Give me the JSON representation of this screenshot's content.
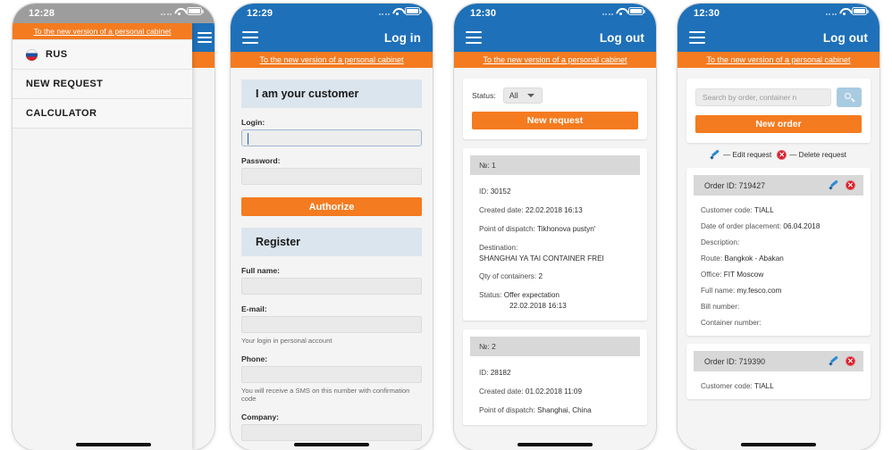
{
  "common": {
    "promo_link": "To the new version of a personal cabinet",
    "menu_icon": "hamburger-menu-icon",
    "wifi_icon": "wifi-icon",
    "battery_icon": "battery-icon"
  },
  "panel1": {
    "status_time": "12:28",
    "drawer": {
      "promo_link": "To the new version of a personal cabinet",
      "items": [
        {
          "label": "RUS",
          "icon": "russia-flag-icon"
        },
        {
          "label": "NEW REQUEST",
          "icon": ""
        },
        {
          "label": "CALCULATOR",
          "icon": ""
        }
      ]
    }
  },
  "panel2": {
    "status_time": "12:29",
    "appbar": {
      "auth_label": "Log in"
    },
    "customer_section": {
      "title": "I am your customer"
    },
    "login_field": {
      "label": "Login:",
      "value": "",
      "placeholder": ""
    },
    "password_field": {
      "label": "Password:",
      "value": "",
      "placeholder": ""
    },
    "authorize_button": "Authorize",
    "register_section": {
      "title": "Register"
    },
    "fullname_field": {
      "label": "Full name:",
      "value": ""
    },
    "email_field": {
      "label": "E-mail:",
      "value": "",
      "hint": "Your login in personal account"
    },
    "phone_field": {
      "label": "Phone:",
      "value": "",
      "hint": "You will receive a SMS on this number with confirmation code"
    },
    "company_field": {
      "label": "Company:",
      "value": ""
    }
  },
  "panel3": {
    "status_time": "12:30",
    "appbar": {
      "auth_label": "Log out"
    },
    "filter": {
      "status_label": "Status:",
      "status_value": "All"
    },
    "new_request_button": "New request",
    "requests": [
      {
        "number_label": "№: 1",
        "id_label": "ID:",
        "id_value": "30152",
        "created_label": "Created date:",
        "created_value": "22.02.2018 16:13",
        "dispatch_label": "Point of dispatch:",
        "dispatch_value": "Tikhonova pustyn'",
        "destination_label": "Destination:",
        "destination_value": "SHANGHAI YA TAI CONTAINER FREI",
        "qty_label": "Qty of containers:",
        "qty_value": "2",
        "status_label": "Status:",
        "status_value": "Offer expectation",
        "status_date": "22.02.2018 16:13"
      },
      {
        "number_label": "№: 2",
        "id_label": "ID:",
        "id_value": "28182",
        "created_label": "Created date:",
        "created_value": "01.02.2018 11:09",
        "dispatch_label": "Point of dispatch:",
        "dispatch_value": "Shanghai, China"
      }
    ]
  },
  "panel4": {
    "status_time": "12:30",
    "appbar": {
      "auth_label": "Log out"
    },
    "search": {
      "placeholder": "Search by order, container n",
      "value": "",
      "icon": "search-icon"
    },
    "new_order_button": "New order",
    "legend": {
      "edit": "— Edit request",
      "delete": "— Delete request"
    },
    "orders": [
      {
        "order_id_label": "Order ID:",
        "order_id_value": "719427",
        "customer_code_label": "Customer code:",
        "customer_code_value": "TIALL",
        "date_label": "Date of order placement:",
        "date_value": "06.04.2018",
        "description_label": "Description:",
        "description_value": "",
        "route_label": "Route:",
        "route_value": "Bangkok - Abakan",
        "office_label": "Office:",
        "office_value": "FIT Moscow",
        "fullname_label": "Full name:",
        "fullname_value": "my.fesco.com",
        "bill_label": "Bill number:",
        "bill_value": "",
        "container_label": "Container number:",
        "container_value": ""
      },
      {
        "order_id_label": "Order ID:",
        "order_id_value": "719390",
        "customer_code_label": "Customer code:",
        "customer_code_value": "TIALL"
      }
    ]
  },
  "colors": {
    "brand_blue": "#1e70b8",
    "accent_orange": "#f47b20",
    "section_blue": "#dbe5ee",
    "delete_red": "#d81b28",
    "edit_blue": "#2a8ad4"
  }
}
